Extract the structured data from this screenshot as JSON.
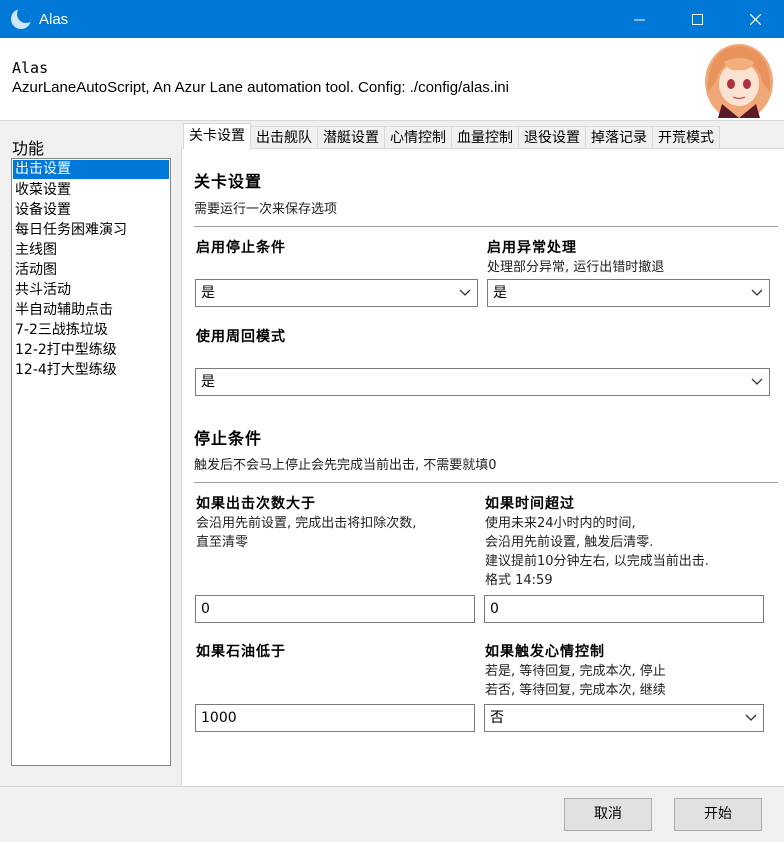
{
  "window": {
    "title": "Alas"
  },
  "header": {
    "name": "Alas",
    "description": "AzurLaneAutoScript, An Azur Lane automation tool. Config: ./config/alas.ini"
  },
  "sidebar": {
    "title": "功能",
    "items": [
      {
        "label": "出击设置",
        "selected": true
      },
      {
        "label": "收菜设置"
      },
      {
        "label": "设备设置"
      },
      {
        "label": "每日任务困难演习"
      },
      {
        "label": "主线图"
      },
      {
        "label": "活动图"
      },
      {
        "label": "共斗活动"
      },
      {
        "label": "半自动辅助点击"
      },
      {
        "label": "7-2三战拣垃圾"
      },
      {
        "label": "12-2打中型练级"
      },
      {
        "label": "12-4打大型练级"
      }
    ]
  },
  "tabs": [
    "关卡设置",
    "出击舰队",
    "潜艇设置",
    "心情控制",
    "血量控制",
    "退役设置",
    "掉落记录",
    "开荒模式"
  ],
  "panel": {
    "section1": {
      "title": "关卡设置",
      "subtitle": "需要运行一次来保存选项"
    },
    "enable_stop": {
      "label": "启用停止条件",
      "value": "是"
    },
    "enable_exception": {
      "label": "启用异常处理",
      "help": "处理部分异常, 运行出错时撤退",
      "value": "是"
    },
    "loop_mode": {
      "label": "使用周回模式",
      "value": "是"
    },
    "section2": {
      "title": "停止条件",
      "subtitle": "触发后不会马上停止会先完成当前出击, 不需要就填0"
    },
    "battle_count": {
      "label": "如果出击次数大于",
      "help": [
        "会沿用先前设置, 完成出击将扣除次数,",
        "直至清零"
      ],
      "value": "0"
    },
    "time_exceed": {
      "label": "如果时间超过",
      "help": [
        "使用未来24小时内的时间,",
        "会沿用先前设置, 触发后清零.",
        "建议提前10分钟左右, 以完成当前出击.",
        "格式 14:59"
      ],
      "value": "0"
    },
    "oil_below": {
      "label": "如果石油低于",
      "value": "1000"
    },
    "emotion_trigger": {
      "label": "如果触发心情控制",
      "help": [
        "若是, 等待回复, 完成本次, 停止",
        "若否, 等待回复, 完成本次, 继续"
      ],
      "value": "否"
    }
  },
  "footer": {
    "cancel": "取消",
    "start": "开始"
  },
  "colors": {
    "titlebar": "#0078d7",
    "selection": "#0078d7"
  }
}
